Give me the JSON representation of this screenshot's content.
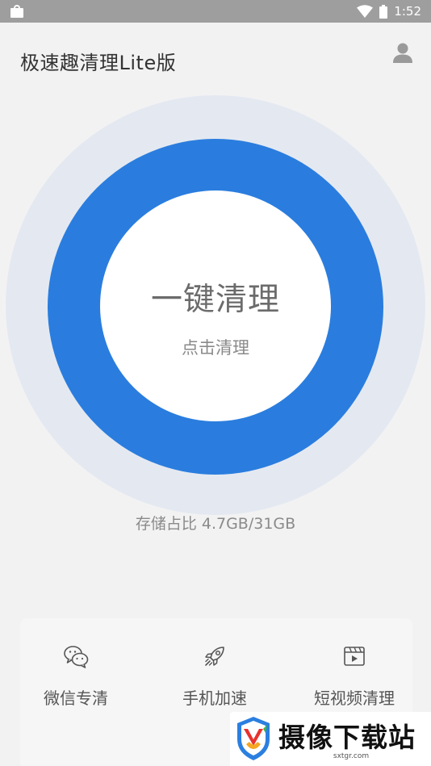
{
  "status_bar": {
    "time": "1:52",
    "left_icon": "shopping-bag-icon",
    "right_icons": [
      "wifi-icon",
      "battery-icon"
    ]
  },
  "header": {
    "title": "极速趣清理Lite版",
    "profile_icon": "user-icon"
  },
  "clean_button": {
    "title": "一键清理",
    "subtitle": "点击清理"
  },
  "storage": {
    "text": "存储占比 4.7GB/31GB"
  },
  "features": [
    {
      "label": "微信专清",
      "icon": "wechat-icon"
    },
    {
      "label": "手机加速",
      "icon": "rocket-icon"
    },
    {
      "label": "短视频清理",
      "icon": "video-clip-icon"
    }
  ],
  "watermark": {
    "text": "摄像下载站",
    "domain": "sxtgr.com"
  },
  "colors": {
    "ring_blue": "#2a7dde",
    "halo": "#e4e9f1",
    "background": "#f3f2f3",
    "status_bar": "#9e9e9e"
  }
}
